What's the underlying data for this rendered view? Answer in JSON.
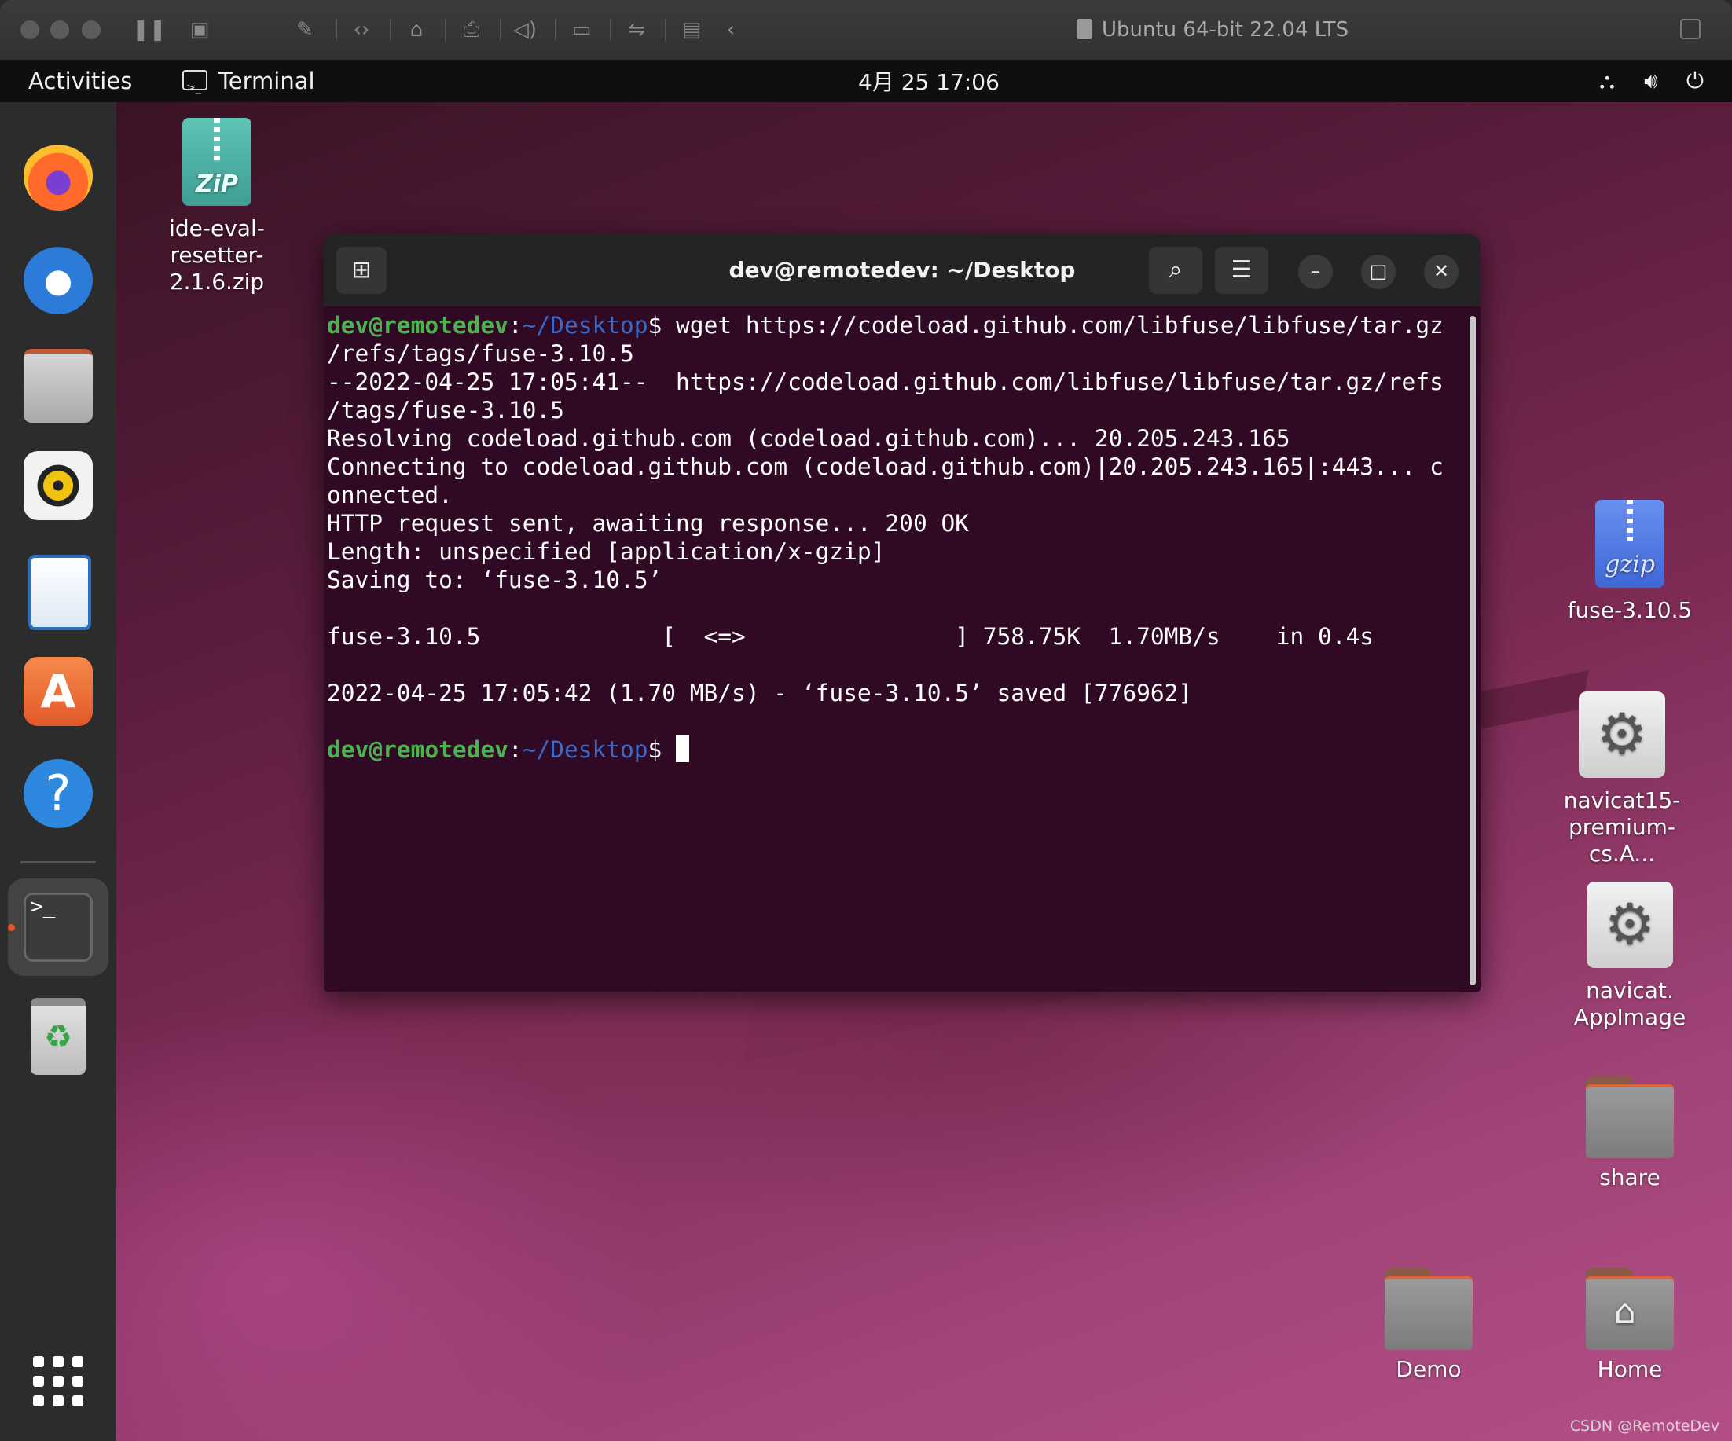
{
  "vm": {
    "title": "Ubuntu 64-bit 22.04 LTS"
  },
  "topbar": {
    "activities": "Activities",
    "app_name": "Terminal",
    "clock": "4月 25  17:06"
  },
  "dock": {
    "items": [
      "firefox-icon",
      "thunderbird-icon",
      "files-icon",
      "rhythmbox-icon",
      "writer-icon",
      "software-icon",
      "help-icon",
      "terminal-icon",
      "trash-icon"
    ]
  },
  "desktop": {
    "icons": {
      "zip_line1": "ide-eval-resetter-",
      "zip_line2": "2.1.6.zip",
      "zip_badge": "ZiP",
      "gz_label": "fuse-3.10.5",
      "gz_badge": "gzip",
      "navicat1_line1": "navicat15-",
      "navicat1_line2": "premium-cs.A...",
      "navicat2_line1": "navicat.",
      "navicat2_line2": "AppImage",
      "share": "share",
      "demo": "Demo",
      "home": "Home"
    }
  },
  "terminal": {
    "title": "dev@remotedev: ~/Desktop",
    "prompt_user": "dev@remotedev",
    "prompt_sep": ":",
    "prompt_path": "~/Desktop",
    "prompt_dollar": "$ ",
    "command_line1": "wget https://codeload.github.com/libfuse/libfuse/tar.gz",
    "lines": [
      "/refs/tags/fuse-3.10.5",
      "--2022-04-25 17:05:41--  https://codeload.github.com/libfuse/libfuse/tar.gz/refs",
      "/tags/fuse-3.10.5",
      "Resolving codeload.github.com (codeload.github.com)... 20.205.243.165",
      "Connecting to codeload.github.com (codeload.github.com)|20.205.243.165|:443... c",
      "onnected.",
      "HTTP request sent, awaiting response... 200 OK",
      "Length: unspecified [application/x-gzip]",
      "Saving to: ‘fuse-3.10.5’",
      "",
      "fuse-3.10.5             [  <=>               ] 758.75K  1.70MB/s    in 0.4s",
      "",
      "2022-04-25 17:05:42 (1.70 MB/s) - ‘fuse-3.10.5’ saved [776962]",
      ""
    ]
  },
  "watermark": "CSDN @RemoteDev"
}
